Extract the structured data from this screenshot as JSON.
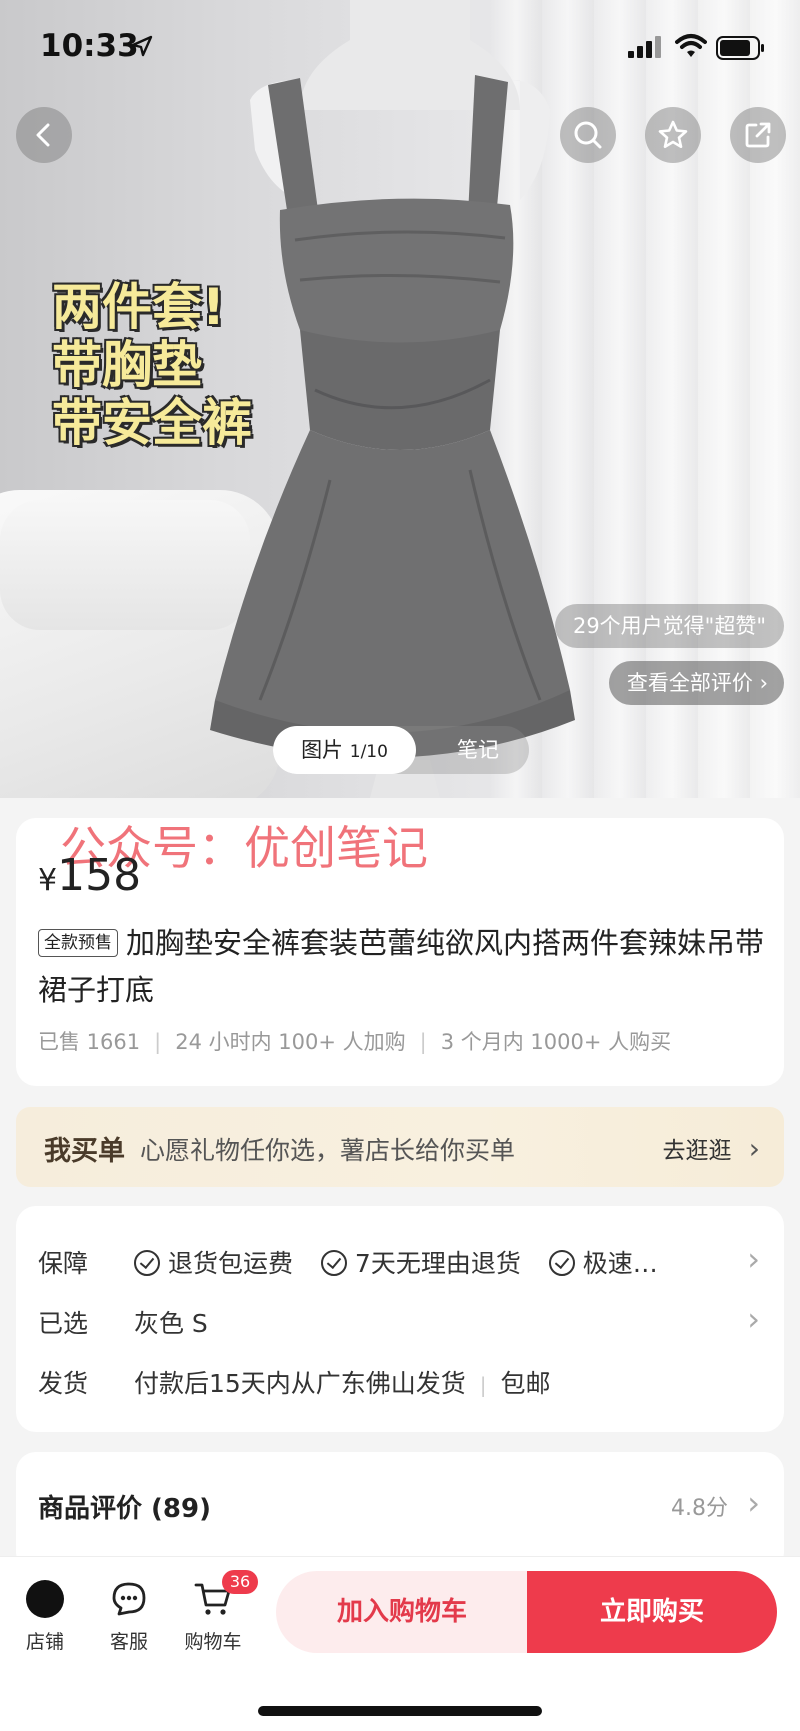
{
  "status_bar": {
    "time": "10:33"
  },
  "hero": {
    "promo_lines": [
      "两件套!",
      "带胸垫",
      "带安全裤"
    ],
    "review_bubble": "29个用户觉得\"超赞\"",
    "all_reviews_link": "查看全部评价",
    "tabs": {
      "active_label": "图片",
      "active_counter": "1/10",
      "inactive_label": "笔记"
    }
  },
  "watermark": "公众号：优创笔记",
  "product": {
    "currency": "¥",
    "price": "158",
    "tag": "全款预售",
    "title": "加胸垫安全裤套装芭蕾纯欲风内搭两件套辣妹吊带裙子打底",
    "stats": [
      "已售 1661",
      "24 小时内 100+ 人加购",
      "3 个月内 1000+ 人购买"
    ]
  },
  "banner": {
    "title": "我买单",
    "desc": "心愿礼物任你选，薯店长给你买单",
    "link": "去逛逛"
  },
  "info": {
    "guarantee_label": "保障",
    "guarantees": [
      "退货包运费",
      "7天无理由退货",
      "极速…"
    ],
    "selected_label": "已选",
    "selected_value": "灰色 S",
    "shipping_label": "发货",
    "shipping_value": "付款后15天内从广东佛山发货",
    "shipping_extra": "包邮"
  },
  "reviews": {
    "heading": "商品评价 (89)",
    "score": "4.8分"
  },
  "bottom_bar": {
    "store_label": "店铺",
    "service_label": "客服",
    "cart_label": "购物车",
    "cart_badge": "36",
    "add_to_cart": "加入购物车",
    "buy_now": "立即购买"
  },
  "colors": {
    "accent": "#ee3b4c",
    "watermark": "#f0737a",
    "banner_bg": "#f6eddc"
  }
}
